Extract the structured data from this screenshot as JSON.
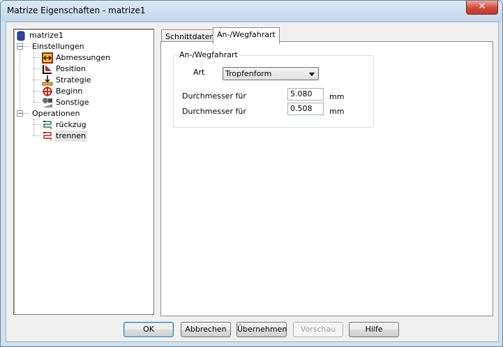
{
  "window": {
    "title": "Matrize Eigenschaften - matrize1",
    "close_label": "✕"
  },
  "tree": {
    "root": "matrize1",
    "einstellungen": "Einstellungen",
    "abmessungen": "Abmessungen",
    "position": "Position",
    "strategie": "Strategie",
    "beginn": "Beginn",
    "sonstige": "Sonstige",
    "operationen": "Operationen",
    "rueckzug": "rückzug",
    "trennen": "trennen",
    "expander_symbol": "−"
  },
  "tabs": {
    "schnittdaten": "Schnittdaten",
    "anweg": "An-/Wegfahrart"
  },
  "group": {
    "legend": "An-/Wegfahrart",
    "art_label": "Art",
    "art_value": "Tropfenform",
    "d1_label": "Durchmesser für",
    "d1_value": "5.080",
    "d1_unit": "mm",
    "d2_label": "Durchmesser für",
    "d2_value": "0.508",
    "d2_unit": "mm"
  },
  "buttons": {
    "ok": "OK",
    "abbrechen": "Abbrechen",
    "uebernehmen": "Übernehmen",
    "vorschau": "Vorschau",
    "hilfe": "Hilfe"
  },
  "colors": {
    "titlebar": "#c3d6ea",
    "close": "#c0392b",
    "dialog_bg": "#f0f0f0"
  }
}
